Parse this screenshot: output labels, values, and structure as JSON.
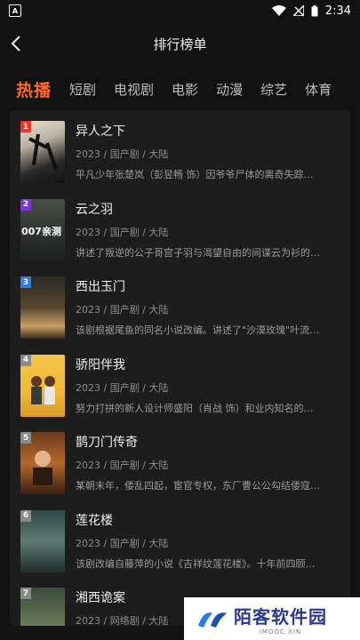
{
  "status": {
    "time": "2:34",
    "app_icon_letter": "A"
  },
  "header": {
    "title": "排行榜单"
  },
  "tabs": [
    {
      "label": "热播",
      "active": true
    },
    {
      "label": "短剧"
    },
    {
      "label": "电视剧"
    },
    {
      "label": "电影"
    },
    {
      "label": "动漫"
    },
    {
      "label": "综艺"
    },
    {
      "label": "体育"
    }
  ],
  "items": [
    {
      "rank": "1",
      "rank_color": "#e8372f",
      "title": "异人之下",
      "meta": "2023 / 国产剧 / 大陆",
      "desc": "平凡少年张楚岚（彭昱畅 饰）因爷爷尸体的离奇失踪…",
      "poster_text": ""
    },
    {
      "rank": "2",
      "rank_color": "#7a35d9",
      "title": "云之羽",
      "meta": "2023 / 国产剧 / 大陆",
      "desc": "讲述了叛逆的公子哥宫子羽与渴望自由的间谍云为衫的…",
      "poster_text": "007亲测"
    },
    {
      "rank": "3",
      "rank_color": "#2f7de0",
      "title": "西出玉门",
      "meta": "2023 / 国产剧 / 大陆",
      "desc": "该剧根据尾鱼的同名小说改编。讲述了\"沙漠玫瑰\"叶流…",
      "poster_text": ""
    },
    {
      "rank": "4",
      "rank_color": "#8a8a8a",
      "title": "骄阳伴我",
      "meta": "2023 / 国产剧 / 大陆",
      "desc": "努力打拼的新人设计师盛阳（肖战 饰）和业内知名的…",
      "poster_text": ""
    },
    {
      "rank": "5",
      "rank_color": "#8a8a8a",
      "title": "鹊刀门传奇",
      "meta": "2023 / 国产剧 / 大陆",
      "desc": "某朝末年，倭乱四起，宦官专权，东厂曹公公勾结倭寇…",
      "poster_text": ""
    },
    {
      "rank": "6",
      "rank_color": "#8a8a8a",
      "title": "莲花楼",
      "meta": "2023 / 国产剧 / 大陆",
      "desc": "该剧改编自藤萍的小说《吉祥纹莲花楼》。十年前四颐…",
      "poster_text": ""
    },
    {
      "rank": "7",
      "rank_color": "#8a8a8a",
      "title": "湘西诡案",
      "meta": "2023 / 网络剧 / 大陆",
      "desc": "",
      "poster_text": ""
    }
  ],
  "watermark": {
    "cn": "陌客软件园",
    "en": "IMOOC.XIN"
  }
}
